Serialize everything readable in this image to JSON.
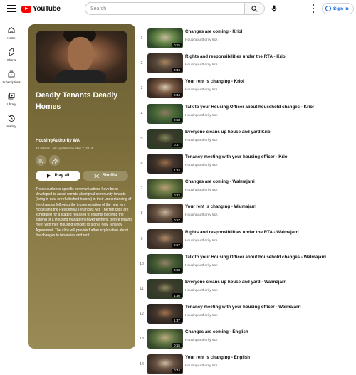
{
  "header": {
    "logo_text": "YouTube",
    "search_placeholder": "Search",
    "signin_label": "Sign in"
  },
  "sidebar": {
    "items": [
      {
        "label": "Home",
        "icon": "home-icon"
      },
      {
        "label": "Shorts",
        "icon": "shorts-icon"
      },
      {
        "label": "Subscriptions",
        "icon": "subscriptions-icon"
      },
      {
        "label": "Library",
        "icon": "library-icon"
      },
      {
        "label": "History",
        "icon": "history-icon"
      }
    ]
  },
  "playlist": {
    "title": "Deadly Tenants Deadly Homes",
    "channel": "HousingAuthority WA",
    "meta": "16 videos   Last updated on May 7, 2014",
    "play_all_label": "Play all",
    "shuffle_label": "Shuffle",
    "description": "These audience specific communications have been developed to assist remote Aboriginal community tenants (living in new or refurbished homes) in their understanding of the changes following the implementation of the new rent model and the Residential Tenancies Act. The film clips are scheduled for a staged released to tenants following the signing of a Housing Management Agreement, before tenants meet with their Housing Officers to sign a new Tenancy Agreement. The clips will provide further explanation about the changes to tenancies and rent."
  },
  "videos": [
    {
      "num": "1",
      "title": "Changes are coming - Kriol",
      "channel": "HousingAuthority WA",
      "duration": "0:15",
      "thumb": [
        "#2f4a2a",
        "#c8b9a0",
        "#6b8a4c"
      ]
    },
    {
      "num": "2",
      "title": "Rights and responsibilities under the RTA - Kriol",
      "channel": "HousingAuthority WA",
      "duration": "0:44",
      "thumb": [
        "#3a2e26",
        "#a8845e",
        "#5a4a3c"
      ]
    },
    {
      "num": "3",
      "title": "Your rent is changing - Kriol",
      "channel": "HousingAuthority WA",
      "duration": "0:44",
      "thumb": [
        "#3b2a22",
        "#d7c6ae",
        "#7a5a44"
      ]
    },
    {
      "num": "4",
      "title": "Talk to your Housing Officer about household changes - Kriol",
      "channel": "HousingAuthority WA",
      "duration": "0:58",
      "thumb": [
        "#2f4a2c",
        "#8d7a62",
        "#4e6b3a"
      ]
    },
    {
      "num": "5",
      "title": "Everyone cleans up house and yard Kriol",
      "channel": "HousingAuthority WA",
      "duration": "0:57",
      "thumb": [
        "#2a3a24",
        "#7f8a5a",
        "#3c3a2a"
      ]
    },
    {
      "num": "6",
      "title": "Tenancy meeting with your housing officer - Kriol",
      "channel": "HousingAuthority WA",
      "duration": "1:24",
      "thumb": [
        "#2a2320",
        "#9a6d4a",
        "#44362c"
      ]
    },
    {
      "num": "7",
      "title": "Changes are coming - Walmajarri",
      "channel": "HousingAuthority WA",
      "duration": "0:22",
      "thumb": [
        "#3b4a2a",
        "#b89f78",
        "#6b7a44"
      ]
    },
    {
      "num": "8",
      "title": "Your rent is changing - Walmajarri",
      "channel": "HousingAuthority WA",
      "duration": "0:57",
      "thumb": [
        "#3d2f26",
        "#c9b49c",
        "#6c5645"
      ]
    },
    {
      "num": "9",
      "title": "Rights and responsibilities under the RTA - Walmajarri",
      "channel": "HousingAuthority WA",
      "duration": "0:57",
      "thumb": [
        "#3a2d25",
        "#b08a66",
        "#564438"
      ]
    },
    {
      "num": "10",
      "title": "Talk to your Housing Officer about household changes - Walmajarri",
      "channel": "HousingAuthority WA",
      "duration": "0:58",
      "thumb": [
        "#2c4128",
        "#96826a",
        "#4b5f36"
      ]
    },
    {
      "num": "11",
      "title": "Everyone cleans up house and yard - Walmajarri",
      "channel": "HousingAuthority WA",
      "duration": "1:30",
      "thumb": [
        "#2d3a26",
        "#8a8a60",
        "#3e3c2c"
      ]
    },
    {
      "num": "12",
      "title": "Tenancy meeting with your housing officer - Walmajarri",
      "channel": "HousingAuthority WA",
      "duration": "1:37",
      "thumb": [
        "#2b2420",
        "#a0714d",
        "#46382d"
      ]
    },
    {
      "num": "13",
      "title": "Changes are coming - English",
      "channel": "HousingAuthority WA",
      "duration": "0:15",
      "thumb": [
        "#34472a",
        "#c0aa84",
        "#667a46"
      ]
    },
    {
      "num": "14",
      "title": "Your rent is changing - English",
      "channel": "HousingAuthority WA",
      "duration": "0:44",
      "thumb": [
        "#3c2d25",
        "#cdb8a0",
        "#6a5444"
      ]
    }
  ],
  "colors": {
    "brand_red": "#ff0000",
    "link_blue": "#065fd4",
    "panel_gradient_top": "#6b5f34",
    "panel_gradient_bottom": "#9a8a55"
  }
}
